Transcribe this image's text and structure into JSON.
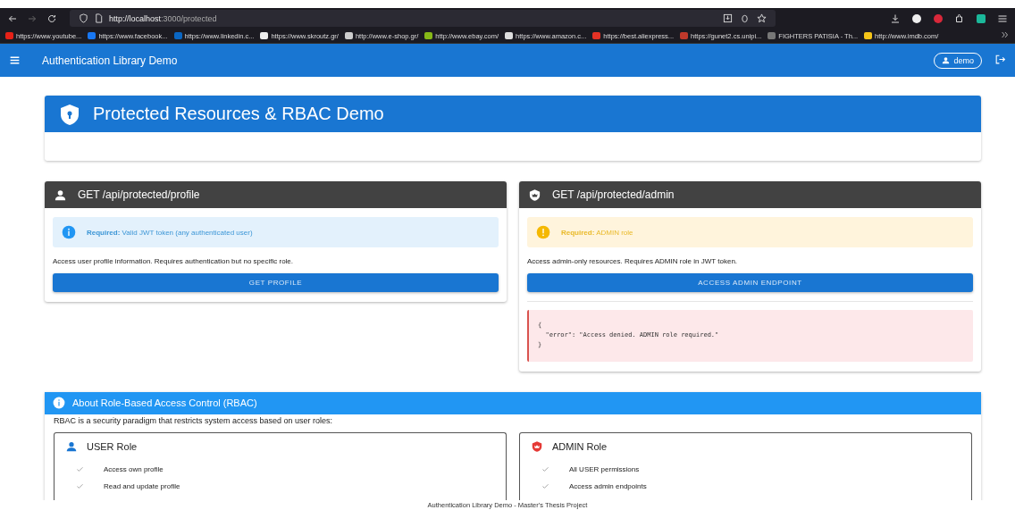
{
  "browser": {
    "url_host": "http://localhost",
    "url_rest": ":3000/protected",
    "forward_disabled": true,
    "bookmarks": [
      {
        "label": "https://www.youtube...",
        "color": "#e62117"
      },
      {
        "label": "https://www.facebook...",
        "color": "#1877f2"
      },
      {
        "label": "https://www.linkedin.c...",
        "color": "#0a66c2"
      },
      {
        "label": "https://www.skroutz.gr/",
        "color": "#eeeeee"
      },
      {
        "label": "http://www.e-shop.gr/",
        "color": "#cccccc"
      },
      {
        "label": "http://www.ebay.com/",
        "color": "#86b817"
      },
      {
        "label": "https://www.amazon.c...",
        "color": "#dddddd"
      },
      {
        "label": "https://best.aliexpress...",
        "color": "#e43225"
      },
      {
        "label": "https://gunet2.cs.unipi...",
        "color": "#c0392b"
      },
      {
        "label": "FIGHTERS PATISIA - Th...",
        "color": "#777777"
      },
      {
        "label": "http://www.imdb.com/",
        "color": "#f5c518"
      }
    ]
  },
  "app_bar": {
    "title": "Authentication Library Demo",
    "user": "demo"
  },
  "page_title": "Protected Resources & RBAC Demo",
  "endpoints": [
    {
      "kind": "user",
      "title": "GET /api/protected/profile",
      "alert": {
        "kind": "info",
        "text": "**Required:** Valid JWT token (any authenticated user)"
      },
      "description": "Access user profile information. Requires authentication but no specific role.",
      "button": "GET PROFILE"
    },
    {
      "kind": "admin",
      "title": "GET /api/protected/admin",
      "alert": {
        "kind": "warning",
        "text": "**Required:** ADMIN role"
      },
      "description": "Access admin-only resources. Requires ADMIN role in JWT token.",
      "button": "ACCESS ADMIN ENDPOINT",
      "response": {
        "kind": "error",
        "text": "{\n  \"error\": \"Access denied. ADMIN role required.\"\n}"
      }
    }
  ],
  "rbac": {
    "title": "About Role-Based Access Control (RBAC)",
    "intro": "RBAC is a security paradigm that restricts system access based on user roles:",
    "roles": [
      {
        "kind": "user",
        "title": "USER Role",
        "permissions": [
          "Access own profile",
          "Read and update profile"
        ]
      },
      {
        "kind": "admin",
        "title": "ADMIN Role",
        "permissions": [
          "All USER permissions",
          "Access admin endpoints"
        ]
      }
    ]
  },
  "footer": "Authentication Library Demo - Master's Thesis Project"
}
